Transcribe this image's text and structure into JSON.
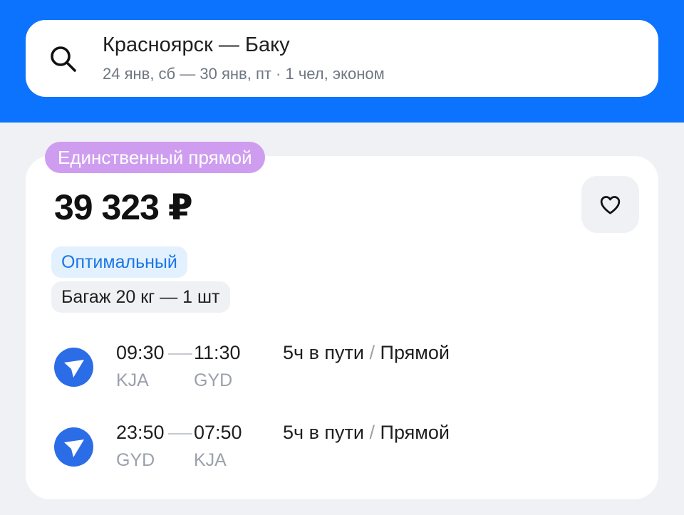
{
  "search": {
    "route": "Красноярск — Баку",
    "details": "24 янв, сб — 30 янв, пт · 1 чел, эконом",
    "icon": "search-icon"
  },
  "offer": {
    "badge": "Единственный прямой",
    "price": "39 323 ₽",
    "favorite_icon": "heart-icon",
    "tags": {
      "optimal": "Оптимальный",
      "baggage": "Багаж 20 кг — 1 шт"
    },
    "segments": [
      {
        "dep_time": "09:30",
        "arr_time": "11:30",
        "dep_code": "KJA",
        "arr_code": "GYD",
        "duration": "5ч в пути",
        "separator": "/",
        "type": "Прямой"
      },
      {
        "dep_time": "23:50",
        "arr_time": "07:50",
        "dep_code": "GYD",
        "arr_code": "KJA",
        "duration": "5ч в пути",
        "separator": "/",
        "type": "Прямой"
      }
    ]
  },
  "colors": {
    "header_blue": "#0c73fe",
    "badge_purple": "#cf9df0",
    "airline_blue": "#2b6de6",
    "optimal_text": "#1b76e6"
  }
}
